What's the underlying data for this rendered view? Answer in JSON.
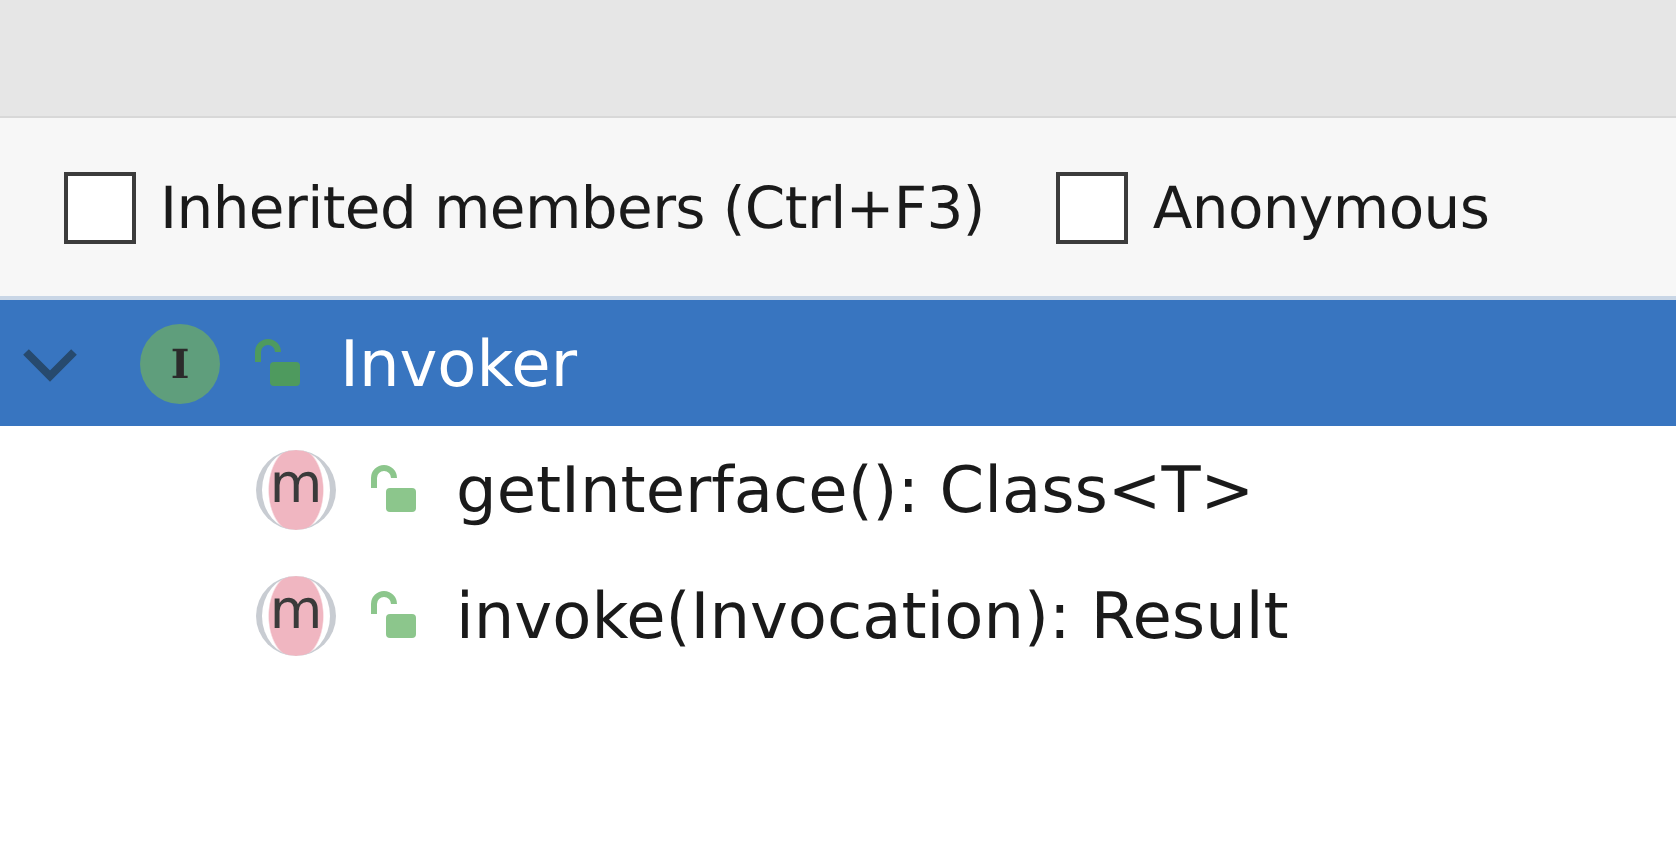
{
  "options": [
    {
      "label": "Inherited members (Ctrl+F3)",
      "checked": false
    },
    {
      "label": "Anonymous",
      "checked": false
    }
  ],
  "tree": [
    {
      "kind": "interface",
      "badge": "I",
      "name": "Invoker",
      "expanded": true,
      "selected": true,
      "children": [
        {
          "kind": "method",
          "badge": "m",
          "name": "getInterface(): Class<T>",
          "selected": false
        },
        {
          "kind": "method",
          "badge": "m",
          "name": "invoke(Invocation): Result",
          "selected": false
        }
      ]
    }
  ]
}
